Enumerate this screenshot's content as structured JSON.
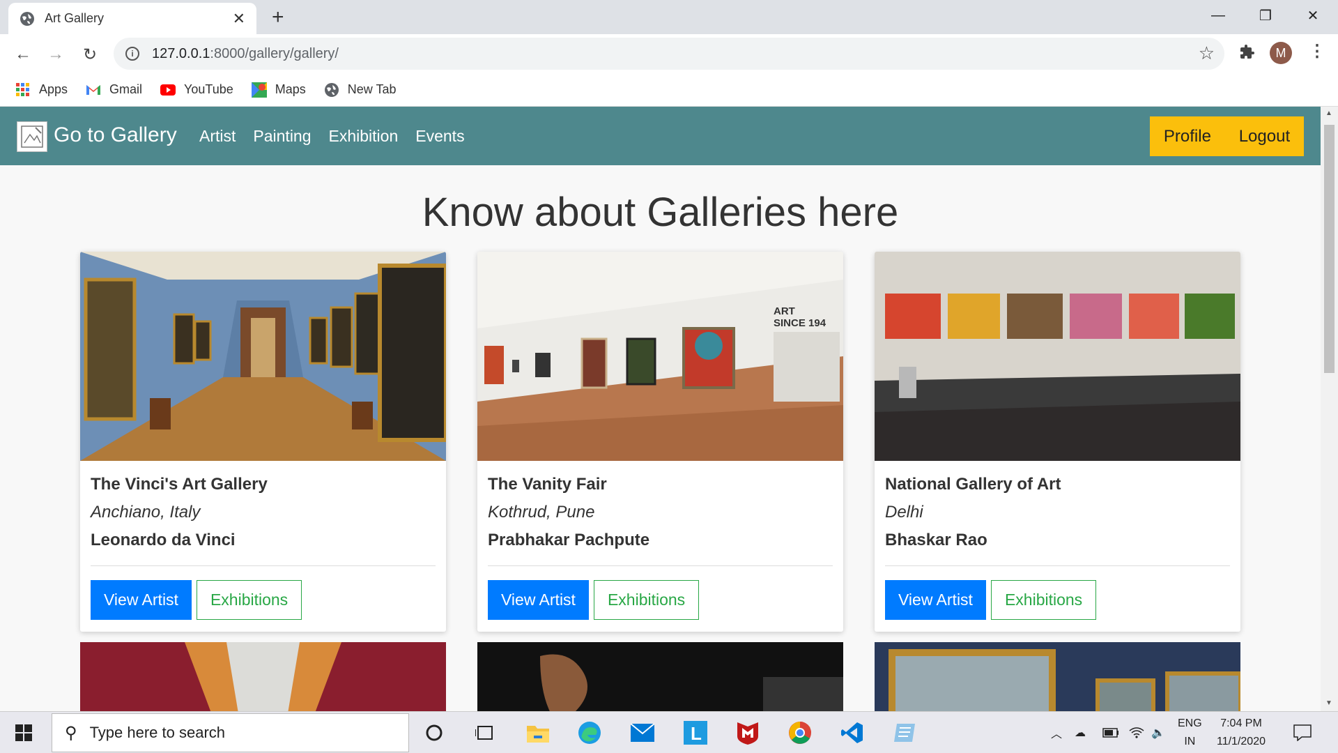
{
  "browser": {
    "tab_title": "Art Gallery",
    "url_host": "127.0.0.1",
    "url_path": ":8000/gallery/gallery/",
    "avatar_letter": "M",
    "bookmarks": [
      {
        "label": "Apps",
        "icon": "apps-grid-icon"
      },
      {
        "label": "Gmail",
        "icon": "gmail-icon"
      },
      {
        "label": "YouTube",
        "icon": "youtube-icon"
      },
      {
        "label": "Maps",
        "icon": "maps-icon"
      },
      {
        "label": "New Tab",
        "icon": "globe-icon"
      }
    ]
  },
  "site": {
    "brand": "Go to Gallery",
    "nav": [
      "Artist",
      "Painting",
      "Exhibition",
      "Events"
    ],
    "profile": "Profile",
    "logout": "Logout",
    "colors": {
      "navbar": "#4e888d",
      "accent": "#fbbf0c",
      "primary": "#007bff",
      "success": "#28a745"
    }
  },
  "page": {
    "heading": "Know about Galleries here",
    "cards": [
      {
        "name": "The Vinci's Art Gallery",
        "location": "Anchiano, Italy",
        "artist": "Leonardo da Vinci",
        "view_label": "View Artist",
        "exhibitions_label": "Exhibitions"
      },
      {
        "name": "The Vanity Fair",
        "location": "Kothrud, Pune",
        "artist": "Prabhakar Pachpute",
        "view_label": "View Artist",
        "exhibitions_label": "Exhibitions"
      },
      {
        "name": "National Gallery of Art",
        "location": "Delhi",
        "artist": "Bhaskar Rao",
        "view_label": "View Artist",
        "exhibitions_label": "Exhibitions"
      }
    ],
    "image_caption_text": "ART SINCE 194"
  },
  "taskbar": {
    "search_placeholder": "Type here to search",
    "lang": "ENG",
    "region": "IN",
    "time": "7:04 PM",
    "date": "11/1/2020"
  }
}
